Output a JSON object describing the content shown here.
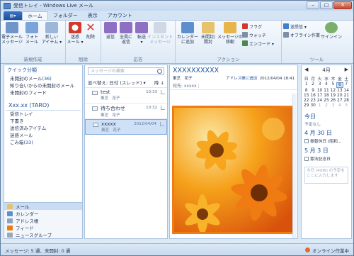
{
  "window": {
    "title": "受信トレイ - Windows Live メール"
  },
  "ribbon": {
    "tabs": [
      "ホーム",
      "フォルダー",
      "表示",
      "アカウント"
    ],
    "groups": [
      {
        "label": "新規作成",
        "buttons": [
          {
            "label": "電子メール\nメッセージ"
          },
          {
            "label": "フォト\nメール"
          },
          {
            "label": "新しい\nアイテム ▾"
          }
        ]
      },
      {
        "label": "削除",
        "buttons": [
          {
            "label": "迷惑\nメール ▾"
          },
          {
            "label": "削除"
          }
        ]
      },
      {
        "label": "応答",
        "buttons": [
          {
            "label": "返信"
          },
          {
            "label": "全員に\n返信"
          },
          {
            "label": "転送\n▾"
          },
          {
            "label": "インスタント\nメッセージ"
          }
        ]
      },
      {
        "label": "アクション",
        "buttons": [
          {
            "label": "カレンダー\nに追加"
          },
          {
            "label": "未開封/\n開封"
          },
          {
            "label": "メッセージの\n移動"
          }
        ],
        "small": [
          "フラグ",
          "ウォッチ",
          "エンコード ▾"
        ]
      },
      {
        "label": "ツール",
        "small": [
          "送受信 ▾",
          "オフライン作業"
        ],
        "buttons": [
          {
            "label": "サインイン"
          }
        ]
      }
    ],
    "colors": {
      "accent": "#1d4f9b",
      "photo_border": "#ef7b12"
    }
  },
  "leftpane": {
    "quick_title": "クイック分類",
    "quick_items": [
      {
        "label": "未開封のメール",
        "count": "(36)"
      },
      {
        "label": "知り合いからの未開封のメール",
        "count": ""
      },
      {
        "label": "未開封のフィード",
        "count": ""
      }
    ],
    "account": "Xxx.xx (TARO)",
    "folders": [
      {
        "label": "受信トレイ",
        "count": ""
      },
      {
        "label": "下書き",
        "count": ""
      },
      {
        "label": "送信済みアイテム",
        "count": ""
      },
      {
        "label": "迷惑メール",
        "count": ""
      },
      {
        "label": "ごみ箱",
        "count": "(33)"
      }
    ],
    "nav": [
      "メール",
      "カレンダー",
      "アドレス帳",
      "フィード",
      "ニュースグループ"
    ]
  },
  "listpane": {
    "search_placeholder": "メッセージの検索",
    "sort_label": "並べ替え: 日付 (スレッド) ▾",
    "sort_order": "降 ↓",
    "messages": [
      {
        "subject": "test",
        "from": "東芝　花子",
        "time": "10:33"
      },
      {
        "subject": "待ち合わせ",
        "from": "東芝　花子",
        "time": "10:32"
      },
      {
        "subject": "xxxxx",
        "from": "東芝　花子",
        "time": "2012/04/04"
      }
    ]
  },
  "readpane": {
    "subject": "XXXXXXXXXX",
    "from": "東芝　花子",
    "add_contact": "アドレス帳に追加",
    "date": "2012/04/04 18:41",
    "to": "宛先: xxxxx ;"
  },
  "calendar": {
    "month": "4月",
    "weekdays": [
      "日",
      "月",
      "火",
      "水",
      "木",
      "金",
      "土"
    ],
    "days": [
      "1",
      "2",
      "3",
      "4",
      "5",
      "6",
      "7",
      "8",
      "9",
      "10",
      "11",
      "12",
      "13",
      "14",
      "15",
      "16",
      "17",
      "18",
      "19",
      "20",
      "21",
      "22",
      "23",
      "24",
      "25",
      "26",
      "27",
      "28",
      "29",
      "30",
      "1",
      "2",
      "3",
      "4",
      "5"
    ],
    "today_label": "今日",
    "today_sub": "予定なし",
    "events": [
      {
        "date": "4 月 30 日",
        "items": [
          "振替休日 (昭和…"
        ]
      },
      {
        "date": "5 月 3 日",
        "items": [
          "憲法記念日"
        ]
      }
    ],
    "note": "今日 (4/06) の予定をここに入力します"
  },
  "status": {
    "left": "メッセージ: 5 通、未開封: 0 通",
    "right": "オンライン作業中"
  }
}
